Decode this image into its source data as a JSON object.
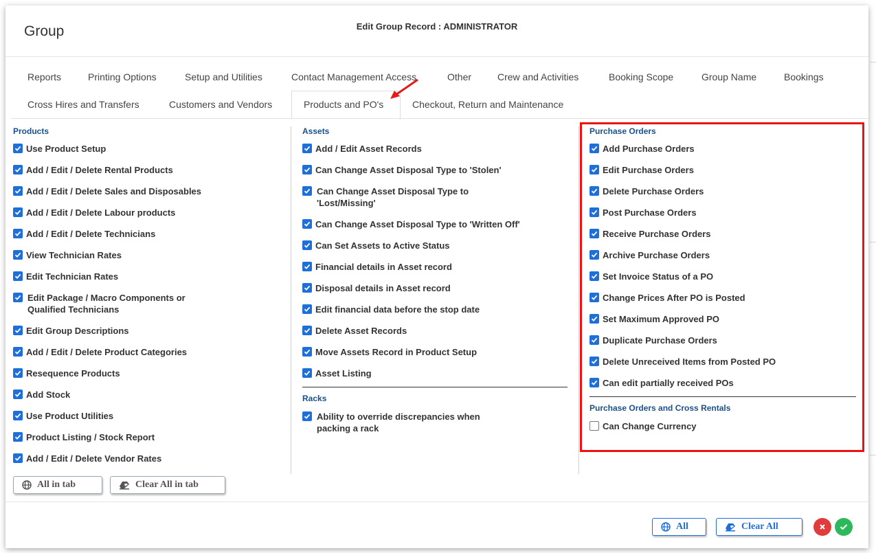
{
  "header": {
    "title": "Group",
    "subtitle": "Edit Group Record : ADMINISTRATOR"
  },
  "tabs": [
    {
      "label": "Reports"
    },
    {
      "label": "Printing Options"
    },
    {
      "label": "Setup and Utilities"
    },
    {
      "label": "Contact Management Access"
    },
    {
      "label": "Other"
    },
    {
      "label": "Crew and Activities"
    },
    {
      "label": "Booking Scope"
    },
    {
      "label": "Group Name"
    },
    {
      "label": "Bookings"
    },
    {
      "label": "Cross Hires and Transfers"
    },
    {
      "label": "Customers and Vendors"
    },
    {
      "label": "Products and PO's"
    },
    {
      "label": "Checkout, Return and Maintenance"
    }
  ],
  "products": {
    "title": "Products",
    "items": [
      {
        "label": "Use Product Setup",
        "checked": true
      },
      {
        "label": "Add / Edit / Delete Rental Products",
        "checked": true
      },
      {
        "label": "Add / Edit / Delete Sales and Disposables",
        "checked": true
      },
      {
        "label": "Add / Edit / Delete Labour products",
        "checked": true
      },
      {
        "label": "Add / Edit / Delete Technicians",
        "checked": true
      },
      {
        "label": "View Technician Rates",
        "checked": true
      },
      {
        "label": "Edit Technician Rates",
        "checked": true
      },
      {
        "label": "Edit Package / Macro Components or",
        "label2": "Qualified Technicians",
        "checked": true
      },
      {
        "label": "Edit Group Descriptions",
        "checked": true
      },
      {
        "label": "Add / Edit / Delete Product Categories",
        "checked": true
      },
      {
        "label": "Resequence Products",
        "checked": true
      },
      {
        "label": "Add Stock",
        "checked": true
      },
      {
        "label": "Use Product Utilities",
        "checked": true
      },
      {
        "label": "Product Listing / Stock Report",
        "checked": true
      },
      {
        "label": "Add / Edit / Delete Vendor Rates",
        "checked": true
      }
    ]
  },
  "assets": {
    "title": "Assets",
    "items": [
      {
        "label": "Add / Edit Asset Records",
        "checked": true
      },
      {
        "label": "Can Change Asset Disposal Type to 'Stolen'",
        "checked": true
      },
      {
        "label": "Can Change Asset Disposal Type to",
        "label2": "'Lost/Missing'",
        "checked": true
      },
      {
        "label": "Can Change Asset Disposal Type to 'Written Off'",
        "checked": true
      },
      {
        "label": "Can Set Assets to Active Status",
        "checked": true
      },
      {
        "label": "Financial details in Asset record",
        "checked": true
      },
      {
        "label": "Disposal details in Asset record",
        "checked": true
      },
      {
        "label": "Edit financial data before the stop date",
        "checked": true
      },
      {
        "label": "Delete Asset Records",
        "checked": true
      },
      {
        "label": "Move Assets Record in Product Setup",
        "checked": true
      },
      {
        "label": "Asset Listing",
        "checked": true
      }
    ]
  },
  "racks": {
    "title": "Racks",
    "items": [
      {
        "label": "Ability to override discrepancies when",
        "label2": "packing a rack",
        "checked": true
      }
    ]
  },
  "purchase_orders": {
    "title": "Purchase Orders",
    "items": [
      {
        "label": "Add Purchase Orders",
        "checked": true
      },
      {
        "label": "Edit Purchase Orders",
        "checked": true
      },
      {
        "label": "Delete Purchase Orders",
        "checked": true
      },
      {
        "label": "Post Purchase Orders",
        "checked": true
      },
      {
        "label": "Receive Purchase Orders",
        "checked": true
      },
      {
        "label": "Archive Purchase Orders",
        "checked": true
      },
      {
        "label": "Set Invoice Status of a PO",
        "checked": true
      },
      {
        "label": "Change Prices After PO is Posted",
        "checked": true
      },
      {
        "label": "Set Maximum Approved PO",
        "checked": true
      },
      {
        "label": "Duplicate Purchase Orders",
        "checked": true
      },
      {
        "label": "Delete Unreceived Items from Posted PO",
        "checked": true
      },
      {
        "label": "Can edit partially received POs",
        "checked": true
      }
    ]
  },
  "po_cross": {
    "title": "Purchase Orders and Cross Rentals",
    "items": [
      {
        "label": "Can Change Currency",
        "checked": false
      }
    ]
  },
  "buttons": {
    "all_in_tab": "All in tab",
    "clear_all_in_tab": "Clear All in tab",
    "all": "All",
    "clear_all": "Clear All"
  },
  "colors": {
    "accent": "#1e6fd9",
    "highlight": "#ee1111",
    "cancel": "#e03c3c",
    "ok": "#2eb85c"
  }
}
